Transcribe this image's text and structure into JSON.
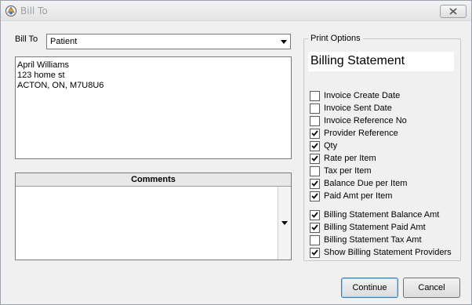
{
  "window": {
    "title": "Bill To"
  },
  "bill_to": {
    "label": "Bill To",
    "selected": "Patient",
    "address_lines": [
      "April Williams",
      "123 home st",
      "ACTON, ON, M7U8U6"
    ]
  },
  "comments": {
    "header": "Comments",
    "value": ""
  },
  "print_options": {
    "legend": "Print Options",
    "statement_title": "Billing Statement",
    "options": [
      {
        "label": "Invoice Create Date",
        "checked": false
      },
      {
        "label": "Invoice Sent Date",
        "checked": false
      },
      {
        "label": "Invoice Reference No",
        "checked": false
      },
      {
        "label": "Provider Reference",
        "checked": true
      },
      {
        "label": "Qty",
        "checked": true
      },
      {
        "label": "Rate per Item",
        "checked": true
      },
      {
        "label": "Tax per Item",
        "checked": false
      },
      {
        "label": "Balance Due per Item",
        "checked": true
      },
      {
        "label": "Paid Amt per Item",
        "checked": true
      },
      {
        "label": "Billing Statement Balance Amt",
        "checked": true
      },
      {
        "label": "Billing Statement Paid Amt",
        "checked": true
      },
      {
        "label": "Billing Statement Tax Amt",
        "checked": false
      },
      {
        "label": "Show Billing Statement Providers",
        "checked": true
      }
    ]
  },
  "buttons": {
    "continue": "Continue",
    "cancel": "Cancel"
  }
}
